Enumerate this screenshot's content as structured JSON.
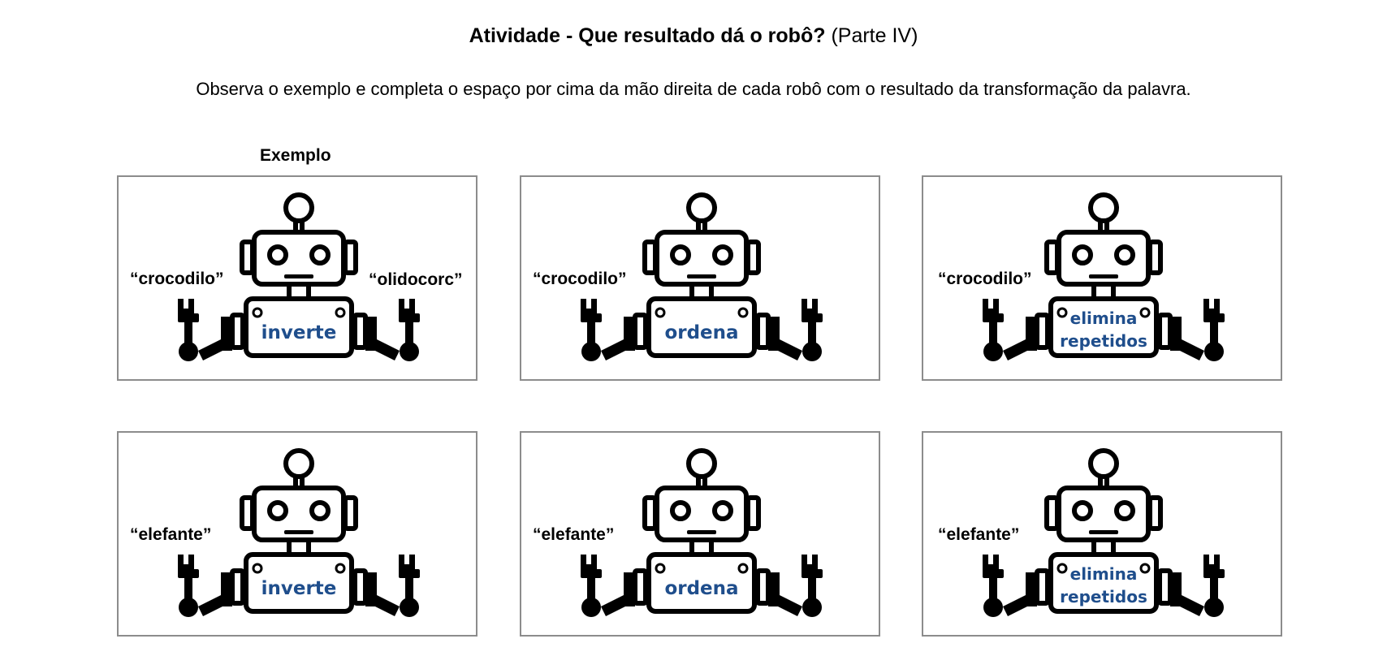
{
  "title": {
    "bold": "Atividade - Que resultado dá o robô?",
    "normal": "(Parte IV)"
  },
  "instructions": "Observa o exemplo e completa o espaço por cima da mão direita de cada robô com o resultado da transformação da palavra.",
  "example_label": "Exemplo",
  "cards": [
    {
      "input": "“crocodilo”",
      "operation_line1": "inverte",
      "operation_line2": "",
      "output": "“olidocorc”"
    },
    {
      "input": "“crocodilo”",
      "operation_line1": "ordena",
      "operation_line2": "",
      "output": ""
    },
    {
      "input": "“crocodilo”",
      "operation_line1": "elimina",
      "operation_line2": "repetidos",
      "output": ""
    },
    {
      "input": "“elefante”",
      "operation_line1": "inverte",
      "operation_line2": "",
      "output": ""
    },
    {
      "input": "“elefante”",
      "operation_line1": "ordena",
      "operation_line2": "",
      "output": ""
    },
    {
      "input": "“elefante”",
      "operation_line1": "elimina",
      "operation_line2": "repetidos",
      "output": ""
    }
  ],
  "colors": {
    "operation_text": "#1f4e8c",
    "card_border": "#8c8c8c",
    "robot": "#000000"
  }
}
